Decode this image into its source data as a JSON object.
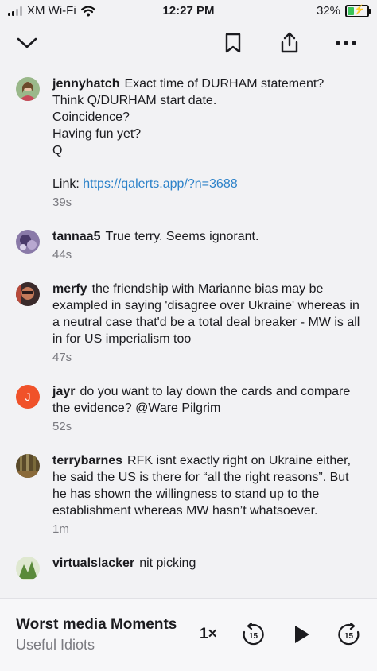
{
  "status": {
    "carrier": "XM Wi-Fi",
    "time": "12:27 PM",
    "battery": "32%",
    "battery_level": 0.32,
    "signal_bars": 2
  },
  "icons": {
    "collapse": "chevron-down-icon",
    "bookmark": "bookmark-icon",
    "share": "share-icon",
    "more": "more-icon"
  },
  "comments": [
    {
      "user": "jennyhatch",
      "body": "Exact time of DURHAM statement?\nThink Q/DURHAM start date.\nCoincidence?\nHaving fun yet?\nQ\n\n",
      "link_label": "Link: ",
      "link": "https://qalerts.app/?n=3688",
      "time": "39s",
      "avatar_color": "#7a9a6e"
    },
    {
      "user": "tannaa5",
      "body": "True terry.  Seems ignorant.",
      "time": "44s",
      "avatar_color": "#6a5a8a"
    },
    {
      "user": "merfy",
      "body": "the friendship with Marianne bias may be exampled in saying 'disagree over Ukraine' whereas in a neutral case that'd be a total deal breaker - MW is all in for US imperialism too",
      "time": "47s",
      "avatar_color": "#8a4a3a"
    },
    {
      "user": "jayr",
      "body": "do you want to lay down the cards and compare the evidence? @Ware Pilgrim",
      "time": "52s",
      "avatar_color": "#f0522a",
      "avatar_letter": "J"
    },
    {
      "user": "terrybarnes",
      "body": "RFK isnt exactly right on Ukraine either, he said the US is there for “all the right reasons”. But he has shown the willingness to stand up to the establishment whereas MW hasn’t whatsoever.",
      "time": "1m",
      "avatar_color": "#6e5a3a"
    },
    {
      "user": "virtualslacker",
      "body": "nit picking",
      "time": "",
      "avatar_color": "#6a8a4a"
    }
  ],
  "player": {
    "title": "Worst media Moments",
    "subtitle": "Useful Idiots",
    "speed": "1×",
    "skip_back": "15",
    "skip_forward": "15"
  }
}
